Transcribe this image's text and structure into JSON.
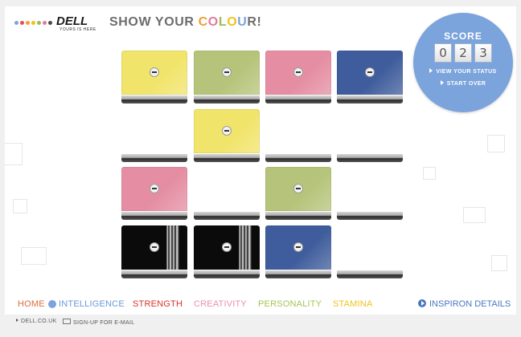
{
  "header": {
    "brand": "DELL",
    "tagline": "YOURS IS HERE",
    "headline": [
      {
        "text": "SHOW YOUR ",
        "color": "#6c6c6c"
      },
      {
        "text": "C",
        "color": "#f29e36"
      },
      {
        "text": "O",
        "color": "#e47a9c"
      },
      {
        "text": "L",
        "color": "#9bbb59"
      },
      {
        "text": "O",
        "color": "#f2c318"
      },
      {
        "text": "U",
        "color": "#7ba3dc"
      },
      {
        "text": "R",
        "color": "#6c6c6c"
      },
      {
        "text": "!",
        "color": "#6c6c6c"
      }
    ],
    "logo_dot_colors": [
      "#7ba3dc",
      "#e94e4e",
      "#f29e36",
      "#f2c318",
      "#9bbb59",
      "#e47a9c",
      "#4a4a4a"
    ]
  },
  "score": {
    "label": "SCORE",
    "digits": [
      "0",
      "2",
      "3"
    ],
    "view_status": "VIEW YOUR STATUS",
    "start_over": "START OVER"
  },
  "grid": {
    "colors": {
      "yellow": "#f1e46a",
      "green": "#b5c47a",
      "pink": "#e58ea3",
      "blue": "#3f5d9c",
      "ebony": "#0d0d0d"
    },
    "rows": [
      [
        "yellow",
        "green",
        "pink",
        "blue"
      ],
      [
        "empty",
        "yellow",
        "empty",
        "empty"
      ],
      [
        "pink",
        "empty",
        "green",
        "empty"
      ],
      [
        "ebony",
        "ebony",
        "blue",
        "empty"
      ]
    ]
  },
  "nav": [
    {
      "label": "HOME",
      "color": "#e06b3c",
      "dot": false
    },
    {
      "label": "INTELLIGENCE",
      "color": "#6a9ad8",
      "dot": true
    },
    {
      "label": "STRENGTH",
      "color": "#d9332d",
      "dot": false
    },
    {
      "label": "CREATIVITY",
      "color": "#e890b0",
      "dot": false
    },
    {
      "label": "PERSONALITY",
      "color": "#a6c453",
      "dot": false
    },
    {
      "label": "STAMINA",
      "color": "#f2c318",
      "dot": false
    }
  ],
  "details_label": "INSPIRON DETAILS",
  "footer": {
    "site": "DELL.CO.UK",
    "signup": "SIGN-UP FOR E-MAIL"
  }
}
